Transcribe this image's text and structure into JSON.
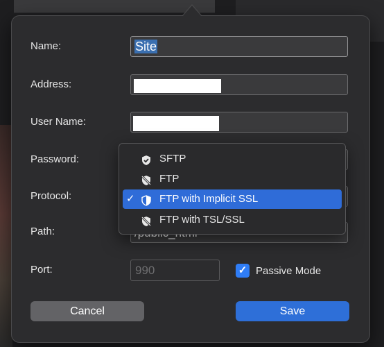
{
  "form": {
    "name_label": "Name:",
    "name_value": "Site",
    "address_label": "Address:",
    "username_label": "User Name:",
    "password_label": "Password:",
    "protocol_label": "Protocol:",
    "path_label": "Path:",
    "path_value": "/public_html",
    "port_label": "Port:",
    "port_placeholder": "990",
    "passive_mode_label": "Passive Mode",
    "passive_mode_checked": true
  },
  "buttons": {
    "cancel_label": "Cancel",
    "save_label": "Save"
  },
  "protocol_menu": {
    "selected": "FTP with Implicit SSL",
    "items": [
      {
        "label": "SFTP",
        "icon": "shield-check-icon"
      },
      {
        "label": "FTP",
        "icon": "shield-slash-icon"
      },
      {
        "label": "FTP with Implicit SSL",
        "icon": "shield-half-icon"
      },
      {
        "label": "FTP with TSL/SSL",
        "icon": "shield-slash-icon"
      }
    ]
  },
  "colors": {
    "accent": "#2f6cd8",
    "popover_bg": "#2c2c2e"
  }
}
